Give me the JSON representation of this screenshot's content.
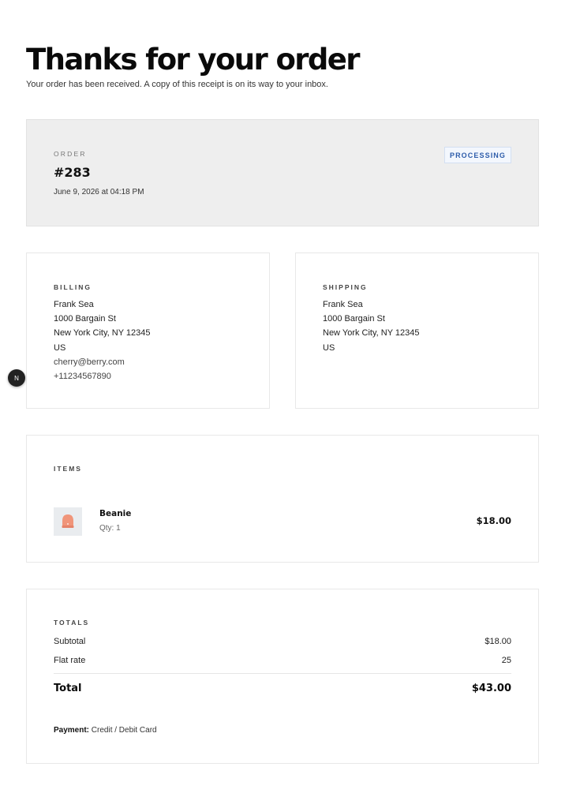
{
  "header": {
    "title": "Thanks for your order",
    "subtitle": "Your order has been received. A copy of this receipt is on its way to your inbox."
  },
  "order": {
    "label": "ORDER",
    "number": "#283",
    "date": "June 9, 2026 at 04:18 PM",
    "status": "PROCESSING",
    "status_color": "#2d5caa"
  },
  "billing": {
    "label": "BILLING",
    "name": "Frank Sea",
    "street": "1000 Bargain St",
    "city_line": "New York City, NY 12345",
    "country": "US",
    "email": "cherry@berry.com",
    "phone": "+11234567890"
  },
  "shipping": {
    "label": "SHIPPING",
    "name": "Frank Sea",
    "street": "1000 Bargain St",
    "city_line": "New York City, NY 12345",
    "country": "US"
  },
  "items": {
    "label": "ITEMS",
    "list": [
      {
        "name": "Beanie",
        "qty": "Qty: 1",
        "price": "$18.00",
        "icon": "beanie-thumbnail-icon",
        "icon_color": "#f0957a"
      }
    ]
  },
  "totals": {
    "label": "TOTALS",
    "subtotal_label": "Subtotal",
    "subtotal_value": "$18.00",
    "shipping_label": "Flat rate",
    "shipping_value": "25",
    "total_label": "Total",
    "total_value": "$43.00",
    "payment_label": "Payment:",
    "payment_method": "Credit / Debit Card"
  },
  "floating_button": {
    "label": "N",
    "icon": "nextjs-logo-icon"
  }
}
